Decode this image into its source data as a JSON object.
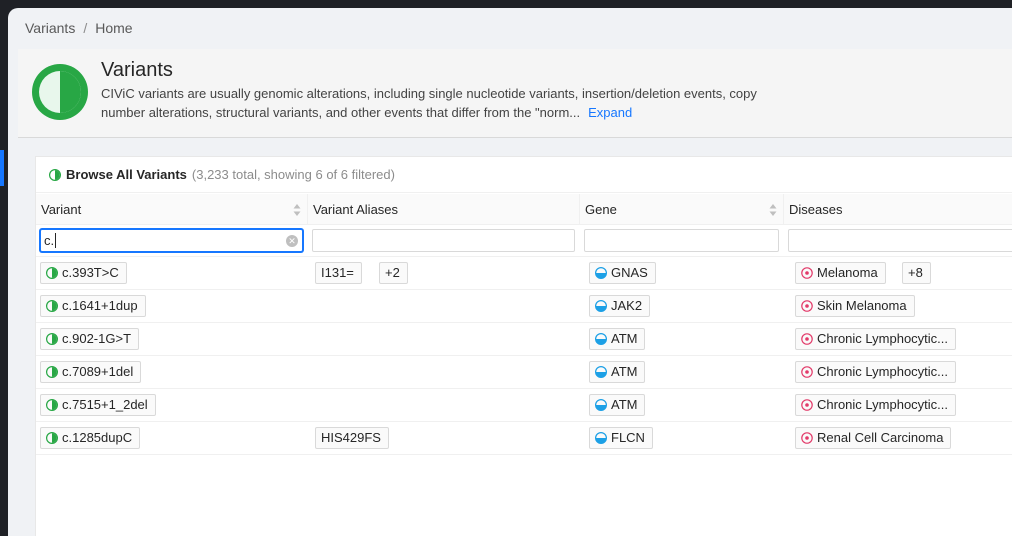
{
  "breadcrumb": {
    "items": [
      "Variants",
      "Home"
    ],
    "separator": "/"
  },
  "header": {
    "title": "Variants",
    "description": "CIViC variants are usually genomic alterations, including single nucleotide variants, insertion/deletion events, copy number alterations, structural variants, and other events that differ from the \"norm...",
    "expand_label": "Expand"
  },
  "table": {
    "title": "Browse All Variants",
    "subtitle": "(3,233 total, showing 6 of 6 filtered)",
    "columns": {
      "variant": "Variant",
      "aliases": "Variant Aliases",
      "gene": "Gene",
      "diseases": "Diseases"
    },
    "filters": {
      "variant": "c.",
      "aliases": "",
      "gene": "",
      "diseases": ""
    },
    "rows": [
      {
        "variant": "c.393T>C",
        "alias": "I131=",
        "alias_more": "+2",
        "gene": "GNAS",
        "disease": "Melanoma",
        "disease_more": "+8"
      },
      {
        "variant": "c.1641+1dup",
        "alias": "",
        "alias_more": "",
        "gene": "JAK2",
        "disease": "Skin Melanoma",
        "disease_more": ""
      },
      {
        "variant": "c.902-1G>T",
        "alias": "",
        "alias_more": "",
        "gene": "ATM",
        "disease": "Chronic Lymphocytic...",
        "disease_more": ""
      },
      {
        "variant": "c.7089+1del",
        "alias": "",
        "alias_more": "",
        "gene": "ATM",
        "disease": "Chronic Lymphocytic...",
        "disease_more": ""
      },
      {
        "variant": "c.7515+1_2del",
        "alias": "",
        "alias_more": "",
        "gene": "ATM",
        "disease": "Chronic Lymphocytic...",
        "disease_more": ""
      },
      {
        "variant": "c.1285dupC",
        "alias": "HIS429FS",
        "alias_more": "",
        "gene": "FLCN",
        "disease": "Renal Cell Carcinoma",
        "disease_more": ""
      }
    ]
  },
  "icons": {
    "variant": "variant-icon",
    "gene": "gene-icon",
    "disease": "disease-icon",
    "clear": "clear-icon",
    "sort": "sort-icon"
  },
  "colors": {
    "variant_green": "#28a745",
    "gene_blue": "#1ca0e6",
    "disease_pink": "#e23a69",
    "accent_blue": "#1677ff"
  }
}
